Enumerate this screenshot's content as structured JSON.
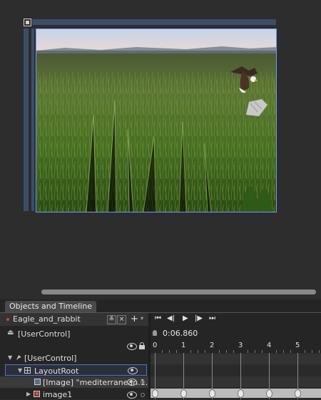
{
  "panel": {
    "tab_label": "Objects and Timeline",
    "storyboard_name": "Eagle_and_rabbit",
    "close_glyph": "×",
    "collapse_glyph": "≚",
    "add_glyph": "+",
    "dropdown_glyph": "▾"
  },
  "tree": {
    "root_label": "[UserControl]",
    "items": [
      {
        "label": "[UserControl]"
      },
      {
        "label": "LayoutRoot"
      },
      {
        "label": "[Image] \"mediterranean.1...\""
      },
      {
        "label": "image1"
      }
    ]
  },
  "timeline": {
    "current_time": "0:06.860",
    "ruler_labels": [
      "0",
      "1",
      "2",
      "3",
      "4",
      "5"
    ],
    "buttons": {
      "go_start": "⏮",
      "prev_frame": "◀|",
      "play": "▶",
      "next_frame": "|▶",
      "go_end": "⏭"
    },
    "keyframe_times_s": [
      0,
      1,
      2,
      3,
      4,
      5
    ]
  },
  "colors": {
    "selection": "#4f74c8",
    "canvas_border": "#6f9bff",
    "ruler": "#3c4d6b"
  }
}
